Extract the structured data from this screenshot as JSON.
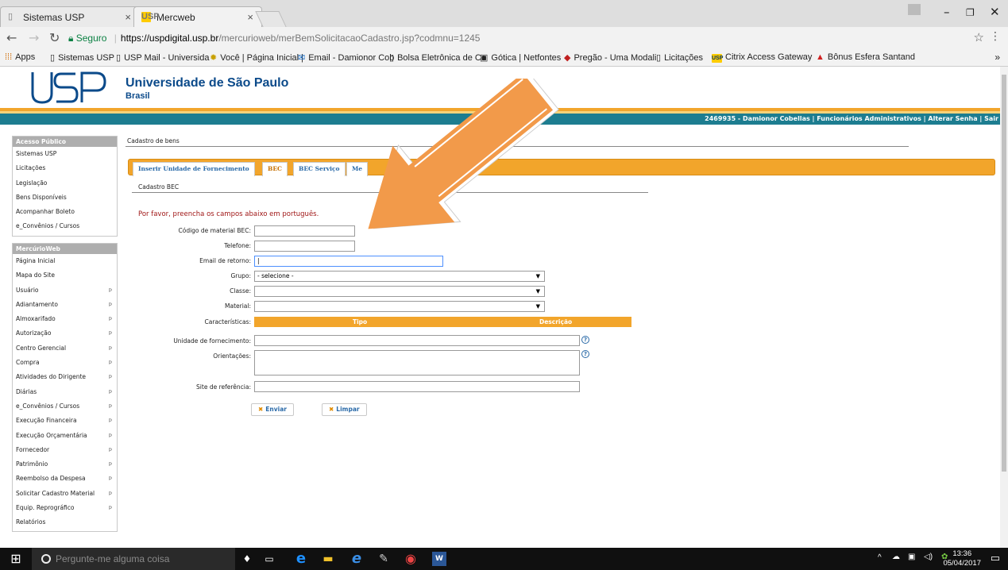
{
  "browser": {
    "tabs": [
      {
        "title": "Sistemas USP"
      },
      {
        "title": "Mercweb"
      }
    ],
    "favicon_text": "USP",
    "url": {
      "secure_label": "Seguro",
      "host": "https://uspdigital.usp.br",
      "path": "/mercurioweb/merBemSolicitacaoCadastro.jsp?codmnu=1245"
    },
    "bookmarks": [
      "Apps",
      "Sistemas USP",
      "USP Mail - Universida",
      "Você | Página Inicial |",
      "Email - Damionor Cob",
      "Bolsa Eletrônica de Cc",
      "Gótica | Netfontes",
      "Pregão - Uma Modali",
      "Licitações",
      "Citrix Access Gateway",
      "Bônus Esfera Santand"
    ]
  },
  "header": {
    "university": "Universidade de São Paulo",
    "country": "Brasil",
    "user_info": "2469935 - Damionor Cobellas | Funcionários Administrativos |",
    "change_password": "Alterar Senha",
    "separator": "|",
    "logout": "Sair"
  },
  "sidebar": {
    "public_title": "Acesso Público",
    "public_items": [
      "Sistemas USP",
      "Licitações",
      "Legislação",
      "Bens Disponíveis",
      "Acompanhar Boleto",
      "e_Convênios / Cursos"
    ],
    "merc_title": "MercúrioWeb",
    "merc_items": [
      {
        "label": "Página Inicial",
        "sub": false
      },
      {
        "label": "Mapa do Site",
        "sub": false
      },
      {
        "label": "Usuário",
        "sub": true
      },
      {
        "label": "Adiantamento",
        "sub": true
      },
      {
        "label": "Almoxarifado",
        "sub": true
      },
      {
        "label": "Autorização",
        "sub": true
      },
      {
        "label": "Centro Gerencial",
        "sub": true
      },
      {
        "label": "Compra",
        "sub": true
      },
      {
        "label": "Atividades do Dirigente",
        "sub": true
      },
      {
        "label": "Diárias",
        "sub": true
      },
      {
        "label": "e_Convênios / Cursos",
        "sub": true
      },
      {
        "label": "Execução Financeira",
        "sub": true
      },
      {
        "label": "Execução Orçamentária",
        "sub": true
      },
      {
        "label": "Fornecedor",
        "sub": true
      },
      {
        "label": "Patrimônio",
        "sub": true
      },
      {
        "label": "Reembolso da Despesa",
        "sub": true
      },
      {
        "label": "Solicitar Cadastro Material",
        "sub": true
      },
      {
        "label": "Equip. Reprográfico",
        "sub": true
      },
      {
        "label": "Relatórios",
        "sub": false
      }
    ],
    "submenu_glyph": "Þ"
  },
  "content": {
    "section_title": "Cadastro de bens",
    "tabs": [
      "Inserir Unidade de Fornecimento",
      "BEC",
      "BEC Serviço",
      "Me"
    ],
    "active_tab": "BEC",
    "subtitle": "Cadastro BEC",
    "notice": "Por favor, preencha os campos abaixo em português.",
    "fields": {
      "codigo_label": "Código de material BEC:",
      "telefone_label": "Telefone:",
      "email_label": "Email de retorno:",
      "grupo_label": "Grupo:",
      "grupo_value": "- selecione -",
      "classe_label": "Classe:",
      "material_label": "Material:",
      "caracteristicas_label": "Características:",
      "tipo_header": "Tipo",
      "descricao_header": "Descrição",
      "unidade_label": "Unidade de fornecimento:",
      "orientacoes_label": "Orientações:",
      "site_label": "Site de referência:"
    },
    "help_glyph": "?",
    "buttons": {
      "x_glyph": "✖",
      "enviar": "Enviar",
      "limpar": "Limpar"
    }
  },
  "taskbar": {
    "search_placeholder": "Pergunte-me alguma coisa",
    "time": "13:36",
    "date": "05/04/2017"
  },
  "colors": {
    "orange": "#f2a52b",
    "teal": "#1d7d90",
    "usp_blue": "#0b4a8a",
    "arrow": "#f29a4a"
  }
}
